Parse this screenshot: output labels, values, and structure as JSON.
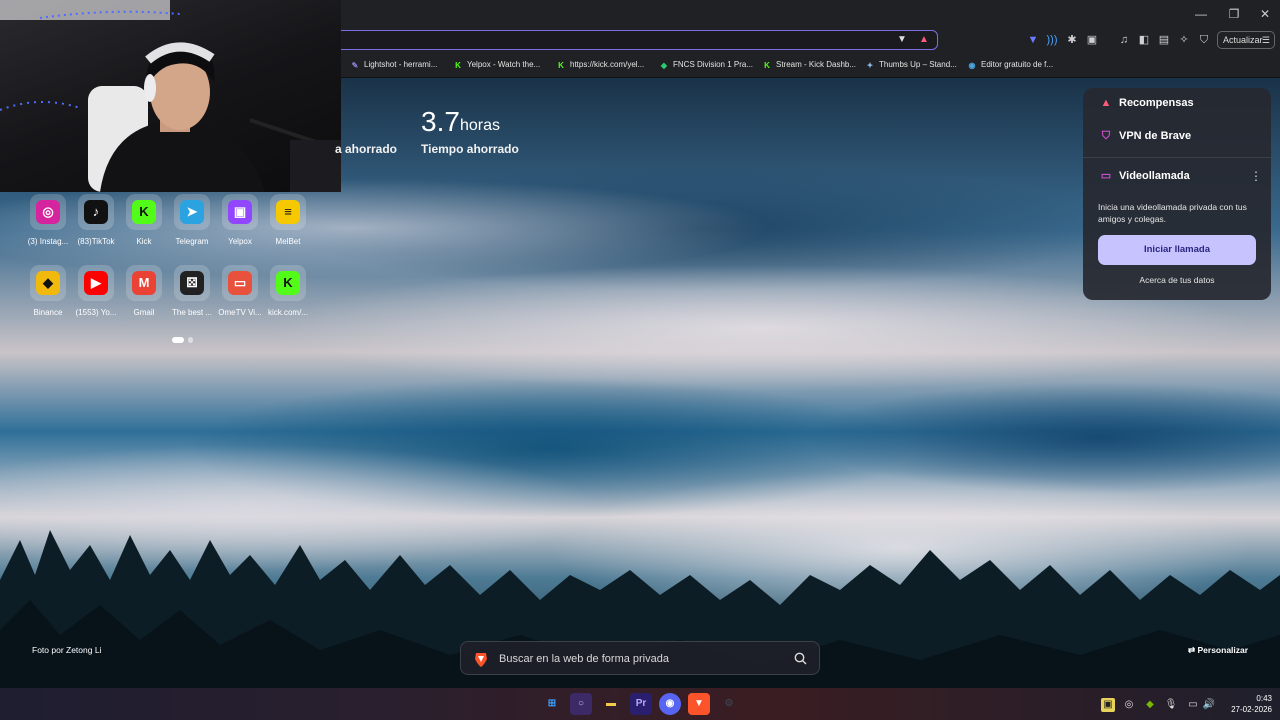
{
  "window": {
    "minimize_glyph": "—",
    "restore_glyph": "❐",
    "close_glyph": "✕"
  },
  "toolbar": {
    "update_label": "Actualizar",
    "menu_glyph": "☰"
  },
  "bookmarks": [
    {
      "label": "Lightshot - herrami...",
      "icon": "feather-icon",
      "color": "#8c7bd6",
      "glyph": "✎"
    },
    {
      "label": "Yelpox - Watch the...",
      "icon": "kick-icon",
      "color": "#53fc18",
      "glyph": "K"
    },
    {
      "label": "https://kick.com/yel...",
      "icon": "kick-icon",
      "color": "#53fc18",
      "glyph": "K"
    },
    {
      "label": "FNCS Division 1 Pra...",
      "icon": "shield-icon",
      "color": "#2ecc71",
      "glyph": "◆"
    },
    {
      "label": "Stream - Kick Dashb...",
      "icon": "kick-icon",
      "color": "#53fc18",
      "glyph": "K"
    },
    {
      "label": "Thumbs Up – Stand...",
      "icon": "star-icon",
      "color": "#8fb6e8",
      "glyph": "✦"
    },
    {
      "label": "Editor gratuito de f...",
      "icon": "editor-icon",
      "color": "#4aa3df",
      "glyph": "◉"
    }
  ],
  "stats": {
    "hours_value": "3.7",
    "hours_unit": "horas",
    "hours_label": "Tiempo ahorrado",
    "partial_label": "a ahorrado"
  },
  "top_sites": [
    {
      "name": "(3) Instag...",
      "icon": "instagram-icon",
      "color": "#d6249f",
      "glyph": "◎"
    },
    {
      "name": "(83)TikTok",
      "icon": "tiktok-icon",
      "color": "#111111",
      "glyph": "♪"
    },
    {
      "name": "Kick",
      "icon": "kick-icon",
      "color": "#53fc18",
      "glyph": "K"
    },
    {
      "name": "Telegram",
      "icon": "telegram-icon",
      "color": "#2aa3e0",
      "glyph": "➤"
    },
    {
      "name": "Yelpox",
      "icon": "twitch-icon",
      "color": "#9146ff",
      "glyph": "▣"
    },
    {
      "name": "MelBet",
      "icon": "melbet-icon",
      "color": "#f5c800",
      "glyph": "≡"
    },
    {
      "name": "Binance",
      "icon": "binance-icon",
      "color": "#f0b90b",
      "glyph": "◆"
    },
    {
      "name": "(1553) Yo...",
      "icon": "youtube-icon",
      "color": "#ff0000",
      "glyph": "▶"
    },
    {
      "name": "Gmail",
      "icon": "gmail-icon",
      "color": "#ea4335",
      "glyph": "M"
    },
    {
      "name": "The best ...",
      "icon": "dice-icon",
      "color": "#222222",
      "glyph": "⚄"
    },
    {
      "name": "OmeTV Vi...",
      "icon": "ometv-icon",
      "color": "#e8523c",
      "glyph": "▭"
    },
    {
      "name": "kick.com/...",
      "icon": "kick-icon",
      "color": "#53fc18",
      "glyph": "K"
    }
  ],
  "pager": {
    "pages": 2,
    "active": 1
  },
  "brave_panel": {
    "rewards_label": "Recompensas",
    "vpn_label": "VPN de Brave",
    "videocall_label": "Videollamada",
    "videocall_desc": "Inicia una videollamada privada con tus amigos y colegas.",
    "start_call_label": "Iniciar llamada",
    "about_data_label": "Acerca de tus datos",
    "colors": {
      "rewards": "#ff5a7a",
      "vpn": "#d24fd1",
      "videocall": "#c94fd0",
      "button": "#c7c3ff"
    }
  },
  "footer": {
    "photo_credit": "Foto por Zetong Li",
    "customize_label": "Personalizar",
    "customize_glyph": "⇄"
  },
  "search": {
    "placeholder": "Buscar en la web de forma privada"
  },
  "taskbar": {
    "apps": [
      {
        "name": "windows-start",
        "icon": "windows-icon",
        "color": "#3aa0ff",
        "glyph": "⊞"
      },
      {
        "name": "search",
        "icon": "search-circle-icon",
        "color": "#8b5cf6",
        "glyph": "○"
      },
      {
        "name": "file-explorer",
        "icon": "folder-icon",
        "color": "#f7c948",
        "glyph": "▬"
      },
      {
        "name": "premiere-pro",
        "icon": "premiere-icon",
        "color": "#2a1f6e",
        "glyph": "Pr"
      },
      {
        "name": "discord",
        "icon": "discord-icon",
        "color": "#5865f2",
        "glyph": "◉"
      },
      {
        "name": "brave",
        "icon": "brave-icon",
        "color": "#fb542b",
        "glyph": "▼"
      },
      {
        "name": "steam",
        "icon": "steam-icon",
        "color": "#3a3f4a",
        "glyph": "⚙"
      }
    ],
    "time": "0:43",
    "date": "27-02-2026"
  }
}
